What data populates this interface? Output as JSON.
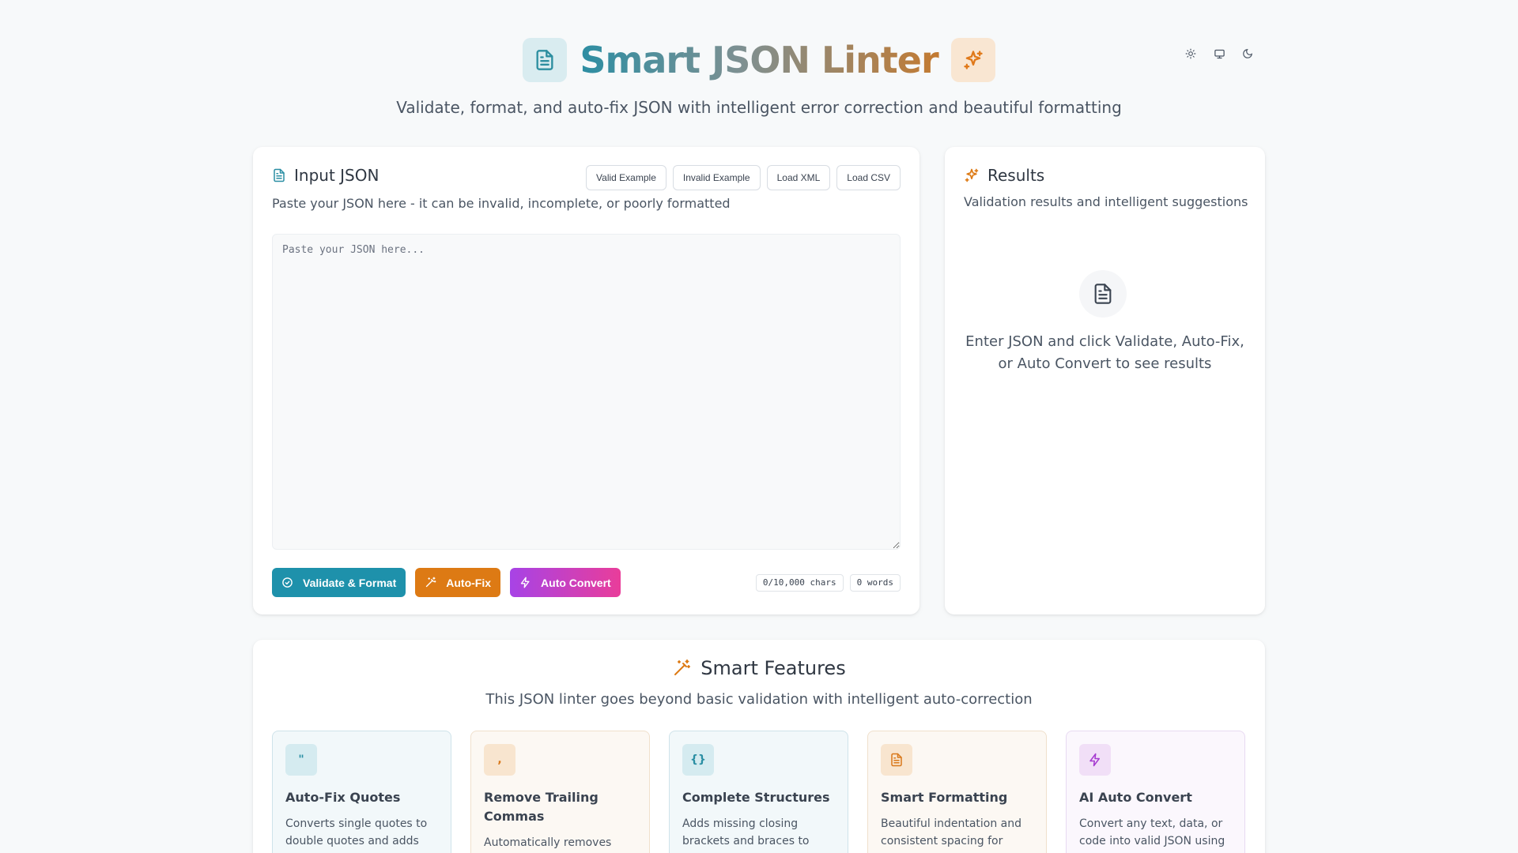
{
  "header": {
    "title": "Smart JSON Linter",
    "subtitle": "Validate, format, and auto-fix JSON with intelligent error correction and beautiful formatting"
  },
  "theme": {
    "options": [
      "light",
      "system",
      "dark"
    ]
  },
  "input": {
    "title": "Input JSON",
    "description": "Paste your JSON here - it can be invalid, incomplete, or poorly formatted",
    "example_buttons": [
      "Valid Example",
      "Invalid Example",
      "Load XML",
      "Load CSV"
    ],
    "placeholder": "Paste your JSON here...",
    "value": "",
    "actions": {
      "validate": "Validate & Format",
      "autofix": "Auto-Fix",
      "convert": "Auto Convert"
    },
    "chars": "0/10,000 chars",
    "words": "0 words"
  },
  "results": {
    "title": "Results",
    "description": "Validation results and intelligent suggestions",
    "empty_text": "Enter JSON and click Validate, Auto-Fix, or Auto Convert to see results"
  },
  "features": {
    "title": "Smart Features",
    "description": "This JSON linter goes beyond basic validation with intelligent auto-correction",
    "items": [
      {
        "icon_glyph": "\"",
        "title": "Auto-Fix Quotes",
        "desc": "Converts single quotes to double quotes and adds"
      },
      {
        "icon_glyph": ",",
        "title": "Remove Trailing Commas",
        "desc": "Automatically removes"
      },
      {
        "icon_glyph": "{}",
        "title": "Complete Structures",
        "desc": "Adds missing closing brackets and braces to"
      },
      {
        "icon_glyph": "",
        "title": "Smart Formatting",
        "desc": "Beautiful indentation and consistent spacing for"
      },
      {
        "icon_glyph": "",
        "title": "AI Auto Convert",
        "desc": "Convert any text, data, or code into valid JSON using AI"
      }
    ]
  },
  "colors": {
    "teal": "#1e91ab",
    "orange": "#dd7a14",
    "purple": "#a743e6",
    "pink": "#e93d9a"
  }
}
